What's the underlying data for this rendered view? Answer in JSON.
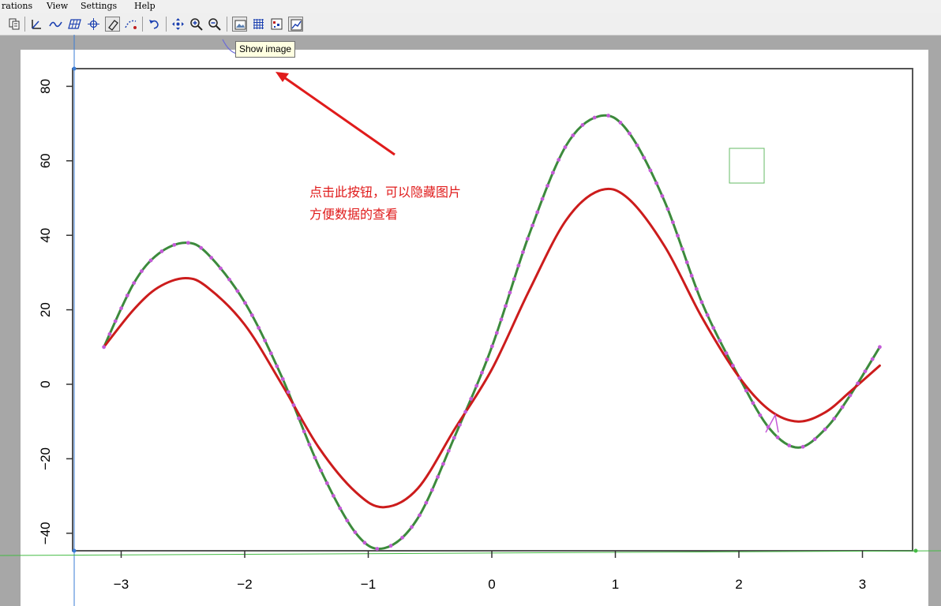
{
  "menu": [
    {
      "label": "rations",
      "icon": null
    },
    {
      "label": "View"
    },
    {
      "label": "Settings"
    },
    {
      "label": "Help"
    }
  ],
  "toolbar": {
    "buttons": [
      "copy-icon",
      "axes-icon",
      "curve-icon",
      "grid-tool-icon",
      "point-match-icon",
      "eraser-icon",
      "segment-fill-icon",
      "undo-icon",
      "pan-icon",
      "zoom-in-icon",
      "zoom-out-icon",
      "show-image-icon",
      "show-grid-icon",
      "show-points-icon",
      "show-curves-icon"
    ]
  },
  "tooltip": "Show image",
  "annotation": {
    "line1": "点击此按钮，可以隐藏图片",
    "line2": "方便数据的查看",
    "color": "#e01b1b"
  },
  "chart_data": {
    "type": "line",
    "xlim": [
      -3.2,
      3.3
    ],
    "ylim": [
      -45,
      85
    ],
    "x_ticks": [
      "−3",
      "−2",
      "−1",
      "0",
      "1",
      "2",
      "3"
    ],
    "y_ticks": [
      "80",
      "60",
      "40",
      "20",
      "0",
      "−20",
      "−40"
    ],
    "series": [
      {
        "color": "#3c8a3c",
        "points": [
          [
            -3.14,
            10
          ],
          [
            -2.9,
            27
          ],
          [
            -2.7,
            35
          ],
          [
            -2.48,
            38
          ],
          [
            -2.3,
            35
          ],
          [
            -2.0,
            22
          ],
          [
            -1.7,
            2
          ],
          [
            -1.4,
            -22
          ],
          [
            -1.1,
            -40
          ],
          [
            -0.87,
            -44
          ],
          [
            -0.6,
            -36
          ],
          [
            -0.3,
            -14
          ],
          [
            0,
            10
          ],
          [
            0.3,
            40
          ],
          [
            0.6,
            64
          ],
          [
            0.87,
            72
          ],
          [
            1.1,
            68
          ],
          [
            1.4,
            49
          ],
          [
            1.7,
            22
          ],
          [
            2.0,
            2
          ],
          [
            2.25,
            -12
          ],
          [
            2.48,
            -17
          ],
          [
            2.7,
            -12
          ],
          [
            2.9,
            -3
          ],
          [
            3.14,
            10
          ]
        ]
      },
      {
        "color": "#cc1c1c",
        "points": [
          [
            -3.14,
            10
          ],
          [
            -2.9,
            20
          ],
          [
            -2.7,
            26
          ],
          [
            -2.48,
            28.5
          ],
          [
            -2.3,
            26
          ],
          [
            -2.0,
            16
          ],
          [
            -1.7,
            0
          ],
          [
            -1.4,
            -17
          ],
          [
            -1.1,
            -29
          ],
          [
            -0.87,
            -33
          ],
          [
            -0.6,
            -28
          ],
          [
            -0.3,
            -12
          ],
          [
            0,
            4
          ],
          [
            0.3,
            25
          ],
          [
            0.6,
            44
          ],
          [
            0.87,
            52
          ],
          [
            1.1,
            50
          ],
          [
            1.4,
            37
          ],
          [
            1.7,
            18
          ],
          [
            2.0,
            2
          ],
          [
            2.25,
            -7
          ],
          [
            2.48,
            -10
          ],
          [
            2.7,
            -7.5
          ],
          [
            2.9,
            -2
          ],
          [
            3.14,
            5
          ]
        ]
      }
    ],
    "digitized_points": {
      "color": "#c45ad8"
    }
  }
}
